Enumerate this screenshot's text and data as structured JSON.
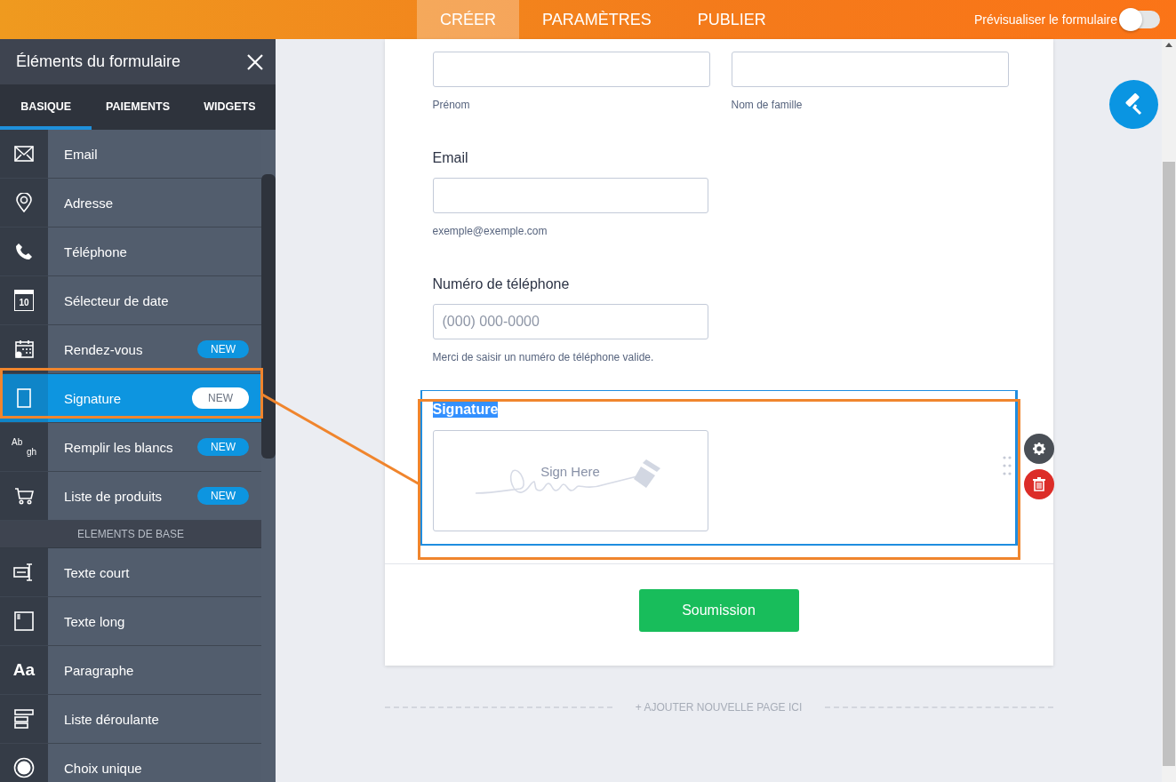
{
  "top_tabs": [
    {
      "label": "CRÉER",
      "selected": true
    },
    {
      "label": "PARAMÈTRES",
      "selected": false
    },
    {
      "label": "PUBLIER",
      "selected": false
    }
  ],
  "preview": {
    "label": "Prévisualiser le formulaire",
    "on": false
  },
  "panel": {
    "title": "Éléments du formulaire",
    "tabs": [
      {
        "label": "BASIQUE",
        "selected": true
      },
      {
        "label": "PAIEMENTS",
        "selected": false
      },
      {
        "label": "WIDGETS",
        "selected": false
      }
    ],
    "items": [
      {
        "kind": "item",
        "label": "Email",
        "selected": false
      },
      {
        "kind": "item",
        "label": "Adresse",
        "selected": false
      },
      {
        "kind": "item",
        "label": "Téléphone",
        "selected": false
      },
      {
        "kind": "item",
        "label": "Sélecteur de date",
        "icon_text": [
          "10"
        ],
        "selected": false
      },
      {
        "kind": "item",
        "label": "Rendez-vous",
        "badge": "NEW",
        "selected": false
      },
      {
        "kind": "item",
        "label": "Signature",
        "badge": "NEW",
        "selected": true
      },
      {
        "kind": "item",
        "label": "Remplir les blancs",
        "icon_text": [
          "Ab",
          "gh"
        ],
        "badge": "NEW",
        "selected": false
      },
      {
        "kind": "item",
        "label": "Liste de produits",
        "badge": "NEW",
        "selected": false
      },
      {
        "kind": "section",
        "label": "ELEMENTS DE BASE"
      },
      {
        "kind": "item",
        "label": "Texte court",
        "selected": false
      },
      {
        "kind": "item",
        "label": "Texte long",
        "selected": false
      },
      {
        "kind": "item",
        "label": "Paragraphe",
        "icon_text": [
          "Aa"
        ],
        "selected": false
      },
      {
        "kind": "item",
        "label": "Liste déroulante",
        "selected": false
      },
      {
        "kind": "item",
        "label": "Choix unique",
        "selected": false
      }
    ]
  },
  "form": {
    "name_sublabels": [
      "Prénom",
      "Nom de famille"
    ],
    "fields": [
      {
        "kind": "text",
        "label": "Email",
        "sublabel": "exemple@exemple.com",
        "selected": false
      },
      {
        "kind": "text",
        "label": "Numéro de téléphone",
        "placeholder": "(000) 000-0000",
        "sublabel": "Merci de saisir un numéro de téléphone valide.",
        "selected": false
      },
      {
        "kind": "signature",
        "label": "Signature",
        "pad_text": "Sign Here",
        "selected": true
      }
    ],
    "submit": "Soumission"
  },
  "add_page": "+ AJOUTER NOUVELLE PAGE ICI"
}
